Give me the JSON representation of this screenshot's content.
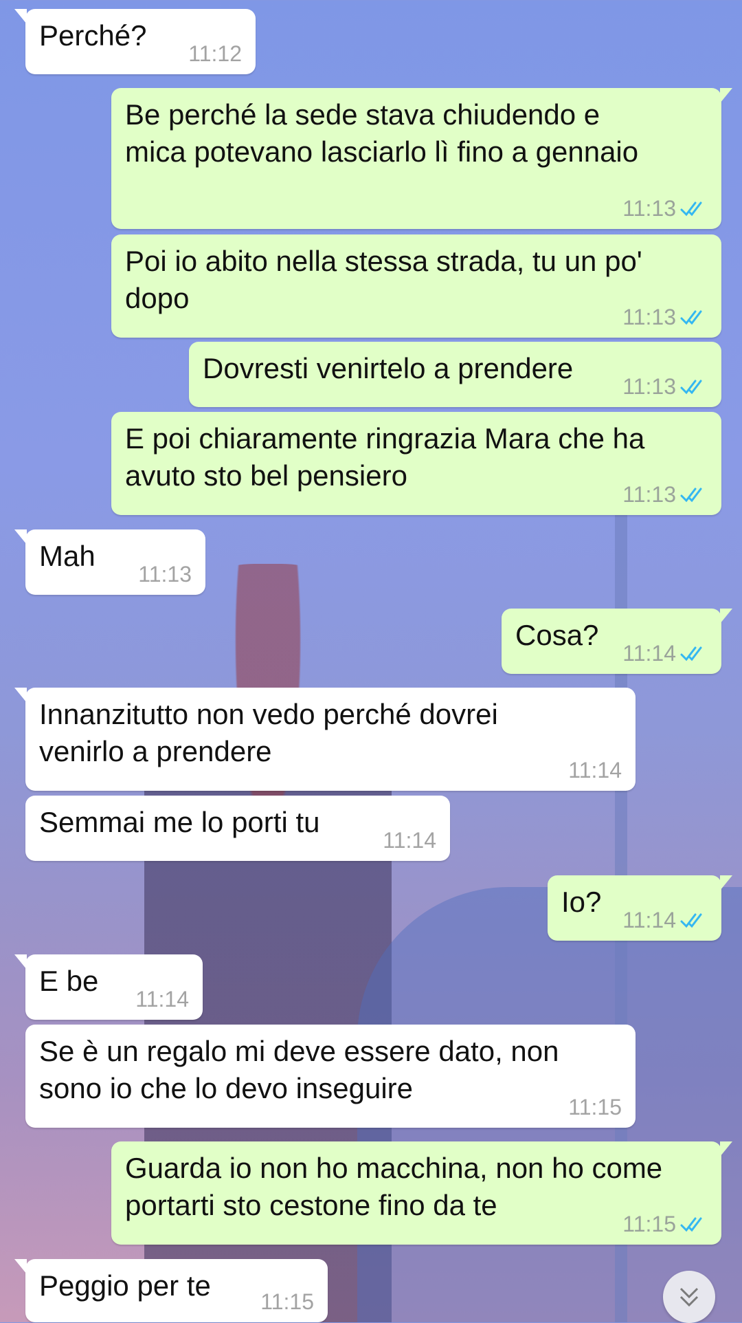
{
  "chat": {
    "messages": [
      {
        "dir": "in",
        "text": "Perché?",
        "time": "11:12"
      },
      {
        "dir": "out",
        "text": "Be perché la sede stava chiudendo e\nmica potevano lasciarlo lì fino a gennaio",
        "time": "11:13",
        "status": "read"
      },
      {
        "dir": "out",
        "text": "Poi io abito nella stessa strada, tu un po'\ndopo",
        "time": "11:13",
        "status": "read"
      },
      {
        "dir": "out",
        "text": "Dovresti venirtelo a prendere",
        "time": "11:13",
        "status": "read"
      },
      {
        "dir": "out",
        "text": "E poi chiaramente ringrazia Mara che ha\navuto sto bel pensiero",
        "time": "11:13",
        "status": "read"
      },
      {
        "dir": "in",
        "text": "Mah",
        "time": "11:13"
      },
      {
        "dir": "out",
        "text": "Cosa?",
        "time": "11:14",
        "status": "read"
      },
      {
        "dir": "in",
        "text": "Innanzitutto non vedo perché dovrei\nvenirlo a prendere",
        "time": "11:14"
      },
      {
        "dir": "in",
        "text": "Semmai me lo porti tu",
        "time": "11:14"
      },
      {
        "dir": "out",
        "text": "Io?",
        "time": "11:14",
        "status": "read"
      },
      {
        "dir": "in",
        "text": "E be",
        "time": "11:14"
      },
      {
        "dir": "in",
        "text": "Se è un regalo mi deve essere dato, non\nsono io che lo devo inseguire",
        "time": "11:15"
      },
      {
        "dir": "out",
        "text": "Guarda io non ho macchina, non ho come\nportarti sto cestone fino da te",
        "time": "11:15",
        "status": "read"
      },
      {
        "dir": "in",
        "text": "Peggio per te",
        "time": "11:15"
      }
    ]
  },
  "icons": {
    "read_tick": "double-check-icon",
    "scroll_down": "chevron-double-down-icon"
  },
  "colors": {
    "incoming_bubble": "#ffffff",
    "outgoing_bubble": "#e1ffc7",
    "read_tick": "#34b7f1"
  }
}
